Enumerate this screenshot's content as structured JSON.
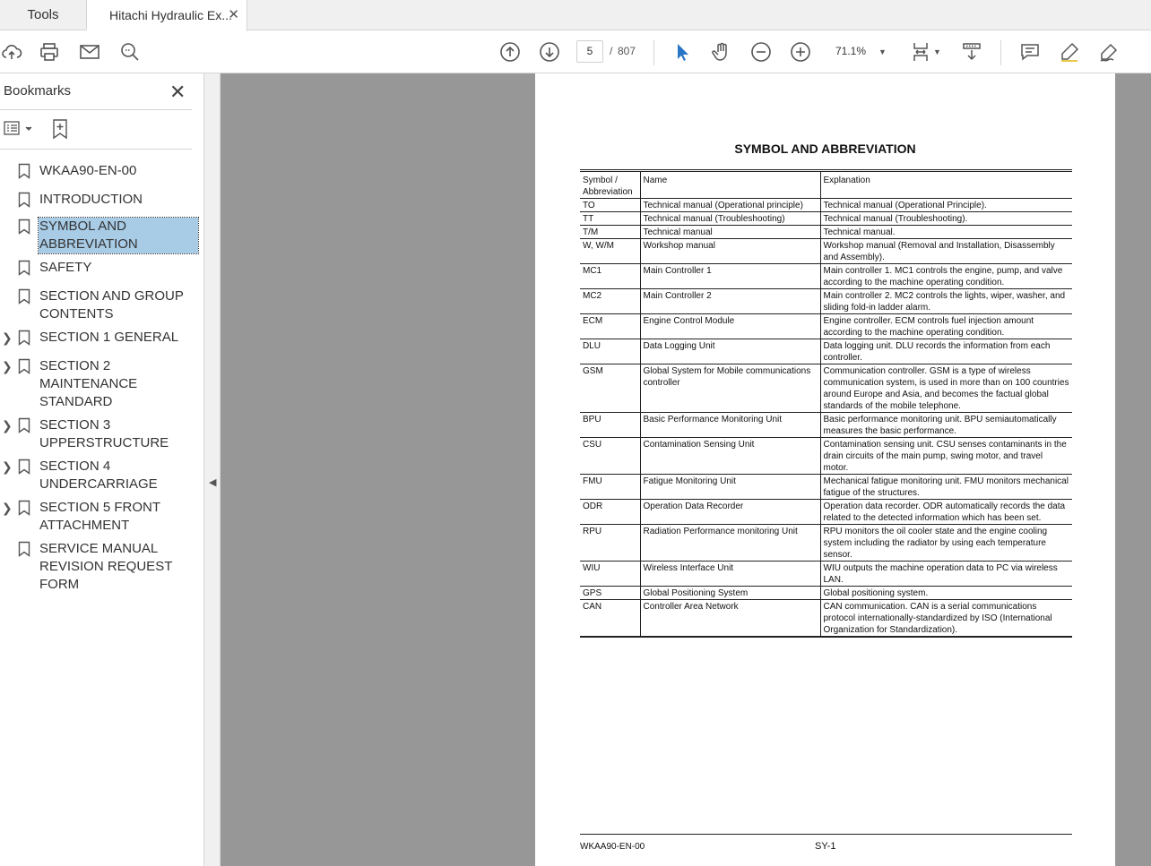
{
  "tabs": {
    "tools": "Tools",
    "document": "Hitachi Hydraulic Ex...",
    "close": "✕"
  },
  "toolbar": {
    "current_page": "5",
    "page_separator": "/",
    "total_pages": "807",
    "zoom": "71.1%"
  },
  "sidebar": {
    "title": "Bookmarks",
    "close": "✕",
    "items": [
      {
        "label": "WKAA90-EN-00",
        "expandable": false
      },
      {
        "label": "INTRODUCTION",
        "expandable": false
      },
      {
        "label": "SYMBOL AND ABBREVIATION",
        "expandable": false,
        "selected": true
      },
      {
        "label": "SAFETY",
        "expandable": false
      },
      {
        "label": "SECTION AND GROUP CONTENTS",
        "expandable": false
      },
      {
        "label": "SECTION 1 GENERAL",
        "expandable": true
      },
      {
        "label": "SECTION 2 MAINTENANCE STANDARD",
        "expandable": true
      },
      {
        "label": "SECTION 3 UPPERSTRUCTURE",
        "expandable": true
      },
      {
        "label": "SECTION 4 UNDERCARRIAGE",
        "expandable": true
      },
      {
        "label": "SECTION 5 FRONT ATTACHMENT",
        "expandable": true
      },
      {
        "label": "SERVICE MANUAL REVISION REQUEST FORM",
        "expandable": false
      }
    ]
  },
  "document": {
    "title": "SYMBOL AND ABBREVIATION",
    "headers": [
      "Symbol / Abbreviation",
      "Name",
      "Explanation"
    ],
    "rows": [
      [
        "TO",
        "Technical manual (Operational principle)",
        "Technical manual (Operational Principle)."
      ],
      [
        "TT",
        "Technical manual (Troubleshooting)",
        "Technical manual (Troubleshooting)."
      ],
      [
        "T/M",
        "Technical manual",
        "Technical manual."
      ],
      [
        "W, W/M",
        "Workshop manual",
        "Workshop manual (Removal and Installation, Disassembly and Assembly)."
      ],
      [
        "MC1",
        "Main Controller 1",
        "Main controller 1. MC1 controls the engine, pump, and valve according to the machine operating condition."
      ],
      [
        "MC2",
        "Main Controller 2",
        "Main controller 2. MC2 controls the lights, wiper, washer, and sliding fold-in ladder alarm."
      ],
      [
        "ECM",
        "Engine Control Module",
        "Engine controller. ECM controls fuel injection amount according to the machine operating condition."
      ],
      [
        "DLU",
        "Data Logging Unit",
        "Data logging unit. DLU records the information from each controller."
      ],
      [
        "GSM",
        "Global System for Mobile communications controller",
        "Communication controller. GSM is a type of wireless communication system, is used in more than on 100 countries around Europe and Asia, and becomes the factual global standards of the mobile telephone."
      ],
      [
        "BPU",
        "Basic Performance Monitoring Unit",
        "Basic performance monitoring unit. BPU semiautomatically measures the basic performance."
      ],
      [
        "CSU",
        "Contamination Sensing Unit",
        "Contamination sensing unit. CSU senses contaminants in the drain circuits of the main pump, swing motor, and travel motor."
      ],
      [
        "FMU",
        "Fatigue Monitoring Unit",
        "Mechanical fatigue monitoring unit. FMU monitors mechanical fatigue of the structures."
      ],
      [
        "ODR",
        "Operation Data Recorder",
        "Operation data recorder. ODR automatically records the data related to the detected information which has been set."
      ],
      [
        "RPU",
        "Radiation Performance monitoring Unit",
        "RPU monitors the oil cooler state and the engine cooling system including the radiator by using each temperature sensor."
      ],
      [
        "WIU",
        "Wireless Interface Unit",
        "WIU outputs the machine operation data to PC via wireless LAN."
      ],
      [
        "GPS",
        "Global Positioning System",
        "Global positioning system."
      ],
      [
        "CAN",
        "Controller Area Network",
        "CAN communication. CAN is a serial communications protocol internationally-standardized by ISO (International Organization for Standardization)."
      ]
    ],
    "footer_left": "WKAA90-EN-00",
    "footer_center": "SY-1"
  }
}
